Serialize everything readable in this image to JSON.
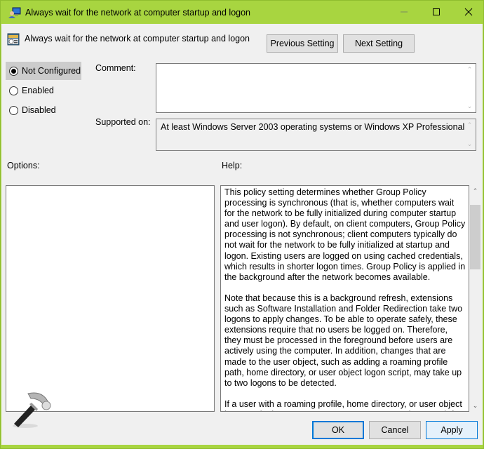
{
  "window": {
    "title": "Always wait for the network at computer startup and logon",
    "accent_color": "#a8d540",
    "controls": {
      "minimize": "minimize",
      "maximize": "maximize",
      "close": "close"
    }
  },
  "header": {
    "policy_title": "Always wait for the network at computer startup and logon",
    "previous_label": "Previous Setting",
    "next_label": "Next Setting"
  },
  "state": {
    "options": [
      {
        "label": "Not Configured",
        "selected": true
      },
      {
        "label": "Enabled",
        "selected": false
      },
      {
        "label": "Disabled",
        "selected": false
      }
    ]
  },
  "comment": {
    "label": "Comment:",
    "value": ""
  },
  "supported": {
    "label": "Supported on:",
    "value": "At least Windows Server 2003 operating systems or Windows XP Professional"
  },
  "options_section": {
    "label": "Options:"
  },
  "help": {
    "label": "Help:",
    "paragraphs": [
      "This policy setting determines whether Group Policy processing is synchronous (that is, whether computers wait for the network to be fully initialized during computer startup and user logon). By default, on client computers, Group Policy processing is not synchronous; client computers typically do not wait for the network to be fully initialized at startup and logon. Existing users are logged on using cached credentials, which results in shorter logon times. Group Policy is applied in the background after the network becomes available.",
      "Note that because this is a background refresh, extensions such as Software Installation and Folder Redirection take two logons to apply changes. To be able to operate safely, these extensions require that no users be logged on. Therefore, they must be processed in the foreground before users are actively using the computer. In addition, changes that are made to the user object, such as adding a roaming profile path, home directory, or user object logon script, may take up to two logons to be detected.",
      "If a user with a roaming profile, home directory, or user object logon script logs on to a computer, computers always wait for"
    ]
  },
  "footer": {
    "ok_label": "OK",
    "cancel_label": "Cancel",
    "apply_label": "Apply"
  },
  "icons": {
    "title_icon": "computer-user-icon",
    "policy_icon": "policy-setting-icon",
    "watermark": "hammer-icon"
  }
}
